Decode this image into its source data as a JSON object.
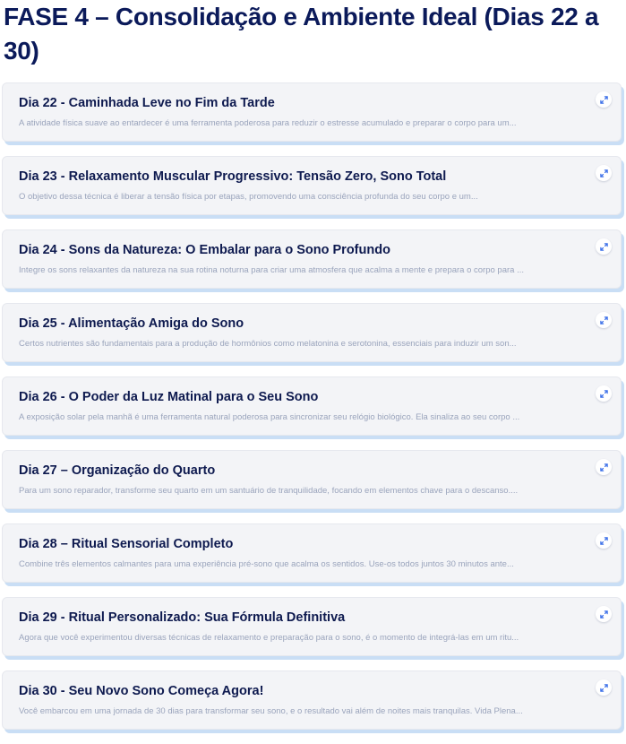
{
  "phase": {
    "title": "FASE 4 – Consolidação e Ambiente Ideal (Dias 22 a 30)"
  },
  "colors": {
    "title": "#0b1a5a",
    "card_bg": "#f3f4f7",
    "card_shadow": "#c9def5",
    "description": "#9aa4bc",
    "expand_icon": "#3a6ee8"
  },
  "icons": {
    "expand": "expand-arrows-icon"
  },
  "days": [
    {
      "title": "Dia 22 - Caminhada Leve no Fim da Tarde",
      "description": "A atividade física suave ao entardecer é uma ferramenta poderosa para reduzir o estresse acumulado e preparar o corpo para um..."
    },
    {
      "title": "Dia 23 - Relaxamento Muscular Progressivo: Tensão Zero, Sono Total",
      "description": "O objetivo dessa técnica é liberar a tensão física por etapas, promovendo uma consciência profunda do seu corpo e um..."
    },
    {
      "title": "Dia 24 - Sons da Natureza: O Embalar para o Sono Profundo",
      "description": "Integre os sons relaxantes da natureza na sua rotina noturna para criar uma atmosfera que acalma a mente e prepara o corpo para ..."
    },
    {
      "title": "Dia 25 - Alimentação Amiga do Sono",
      "description": "Certos nutrientes são fundamentais para a produção de hormônios como melatonina e serotonina, essenciais para induzir um son..."
    },
    {
      "title": "Dia 26 - O Poder da Luz Matinal para o Seu Sono",
      "description": "A exposição solar pela manhã é uma ferramenta natural poderosa para sincronizar seu relógio biológico. Ela sinaliza ao seu corpo ..."
    },
    {
      "title": "Dia 27 – Organização do Quarto",
      "description": "Para um sono reparador, transforme seu quarto em um santuário de tranquilidade, focando em elementos chave para o descanso...."
    },
    {
      "title": "Dia 28 – Ritual Sensorial Completo",
      "description": "Combine três elementos calmantes para uma experiência pré-sono que acalma os sentidos. Use-os todos juntos 30 minutos ante..."
    },
    {
      "title": "Dia 29 - Ritual Personalizado: Sua Fórmula Definitiva",
      "description": "Agora que você experimentou diversas técnicas de relaxamento e preparação para o sono, é o momento de integrá-las em um ritu..."
    },
    {
      "title": "Dia 30 - Seu Novo Sono Começa Agora!",
      "description": "Você embarcou em uma jornada de 30 dias para transformar seu sono, e o resultado vai além de noites mais tranquilas. Vida Plena..."
    }
  ]
}
